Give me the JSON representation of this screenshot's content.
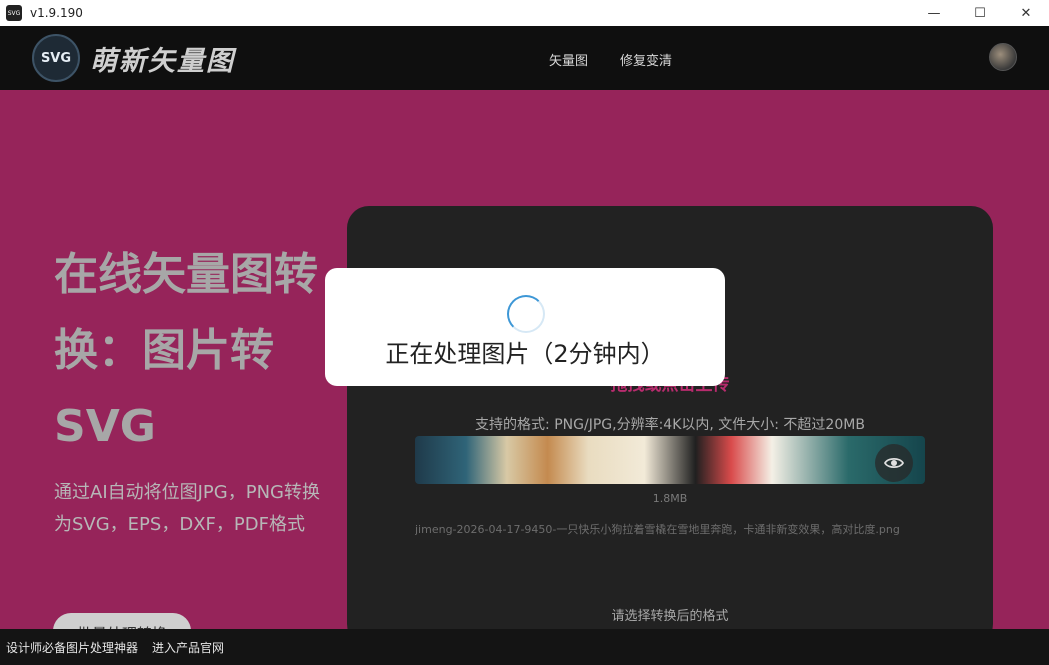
{
  "window": {
    "app_icon": "SVG",
    "version": "v1.9.190",
    "controls": {
      "minimize": "—",
      "maximize": "☐",
      "close": "✕"
    }
  },
  "header": {
    "logo_mark": "SVG",
    "logo_text": "萌新矢量图",
    "nav": [
      {
        "label": "矢量图"
      },
      {
        "label": "修复变清"
      }
    ]
  },
  "hero": {
    "title": "在线矢量图转换：图片转SVG",
    "subtitle": "通过AI自动将位图JPG，PNG转换为SVG，EPS，DXF，PDF格式",
    "button": "批量处理转换"
  },
  "panel": {
    "upload_hint": "拖拽或点击上传",
    "formats": "支持的格式: PNG/JPG,分辨率:4K以内, 文件大小: 不超过20MB",
    "file_size": "1.8MB",
    "file_name": "jimeng-2026-04-17-9450-一只快乐小狗拉着雪橇在雪地里奔跑，卡通非新变效果，高对比度.png",
    "choose_format": "请选择转换后的格式"
  },
  "modal": {
    "text": "正在处理图片（2分钟内）"
  },
  "footer": {
    "links": [
      {
        "label": "设计师必备图片处理神器"
      },
      {
        "label": "进入产品官网"
      }
    ]
  },
  "colors": {
    "hero_bg": "#96245a",
    "header_bg": "#0f0f0f",
    "panel_bg": "#222222",
    "accent": "#b82c6e"
  }
}
